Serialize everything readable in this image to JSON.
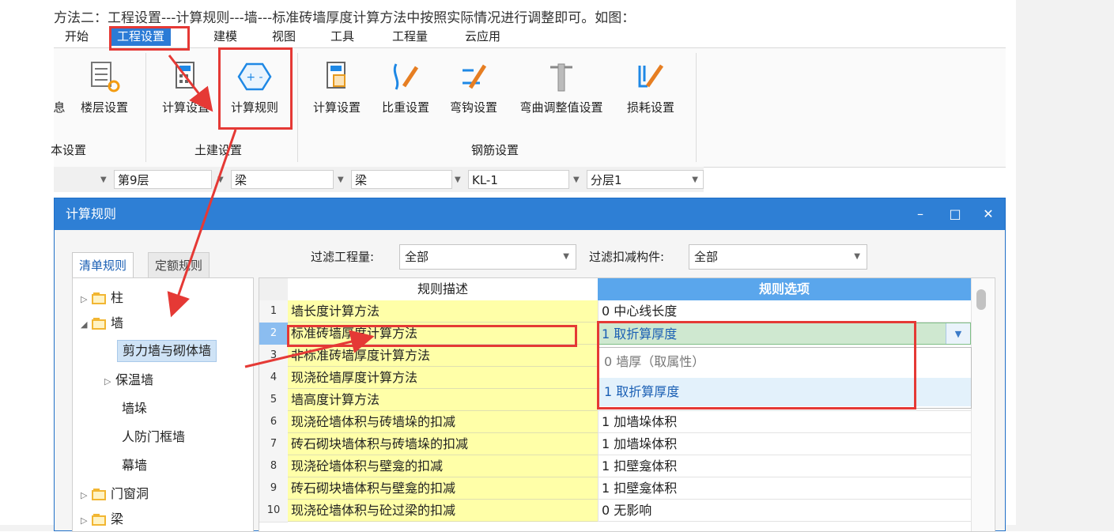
{
  "caption": "方法二：工程设置---计算规则---墙---标准砖墙厚度计算方法中按照实际情况进行调整即可。如图：",
  "menu": [
    "开始",
    "工程设置",
    "建模",
    "视图",
    "工具",
    "工程量",
    "云应用"
  ],
  "ribbon": {
    "base_buttons": [
      "息",
      "楼层设置"
    ],
    "base_group": "本设置",
    "civil_buttons": [
      "计算设置",
      "计算规则"
    ],
    "civil_group": "土建设置",
    "rebar_buttons": [
      "计算设置",
      "比重设置",
      "弯钩设置",
      "弯曲调整值设置",
      "损耗设置"
    ],
    "rebar_group": "钢筋设置"
  },
  "selectors": [
    "第9层",
    "梁",
    "梁",
    "KL-1",
    "分层1"
  ],
  "dialog": {
    "title": "计算规则",
    "tabs": [
      "清单规则",
      "定额规则"
    ],
    "filter_qty_label": "过滤工程量:",
    "filter_qty_value": "全部",
    "filter_deduct_label": "过滤扣减构件:",
    "filter_deduct_value": "全部",
    "tree": [
      "柱",
      "墙",
      "剪力墙与砌体墙",
      "保温墙",
      "墙垛",
      "人防门框墙",
      "幕墙",
      "门窗洞",
      "梁"
    ],
    "grid_headers": [
      "规则描述",
      "规则选项"
    ],
    "rows": [
      {
        "n": "1",
        "desc": "墙长度计算方法",
        "opt": "0   中心线长度"
      },
      {
        "n": "2",
        "desc": "标准砖墙厚度计算方法",
        "opt": "1  取折算厚度"
      },
      {
        "n": "3",
        "desc": "非标准砖墙厚度计算方法",
        "opt": ""
      },
      {
        "n": "4",
        "desc": "现浇砼墙厚度计算方法",
        "opt": ""
      },
      {
        "n": "5",
        "desc": "墙高度计算方法",
        "opt": ""
      },
      {
        "n": "6",
        "desc": "现浇砼墙体积与砖墙垛的扣减",
        "opt": "1   加墙垛体积"
      },
      {
        "n": "7",
        "desc": "砖石砌块墙体积与砖墙垛的扣减",
        "opt": "1   加墙垛体积"
      },
      {
        "n": "8",
        "desc": "现浇砼墙体积与壁龛的扣减",
        "opt": "1   扣壁龛体积"
      },
      {
        "n": "9",
        "desc": "砖石砌块墙体积与壁龛的扣减",
        "opt": "1   扣壁龛体积"
      },
      {
        "n": "10",
        "desc": "现浇砼墙体积与砼过梁的扣减",
        "opt": "0   无影响"
      }
    ],
    "dropdown_options": [
      "0  墙厚（取属性）",
      "1  取折算厚度"
    ]
  }
}
